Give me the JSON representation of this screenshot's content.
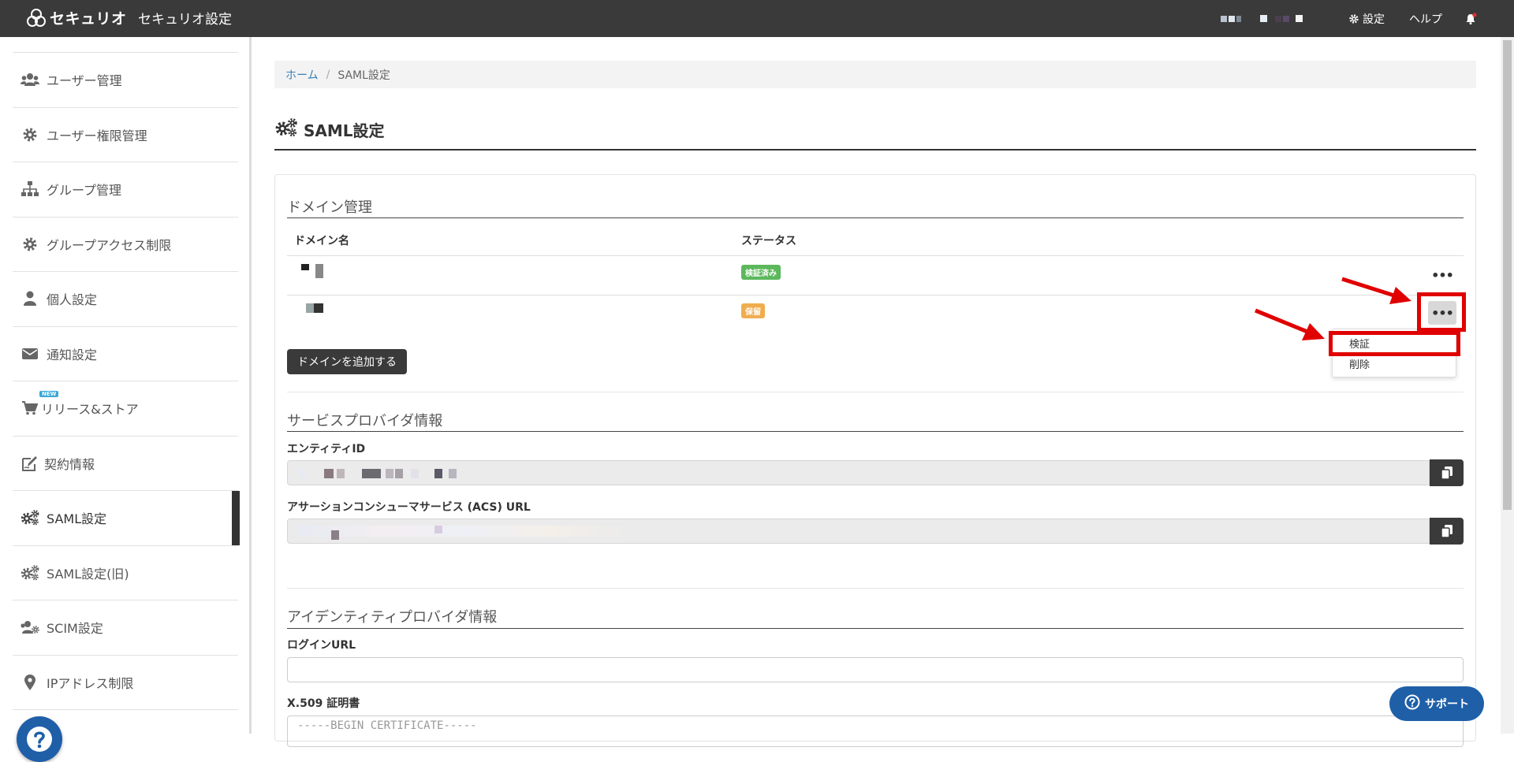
{
  "header": {
    "logo_text": "セキュリオ",
    "app_title": "セキュリオ設定",
    "settings_label": "設定",
    "help_label": "ヘルプ"
  },
  "sidebar": {
    "items": [
      {
        "label": "ユーザー管理",
        "icon": "users-icon"
      },
      {
        "label": "ユーザー権限管理",
        "icon": "gear-icon"
      },
      {
        "label": "グループ管理",
        "icon": "sitemap-icon"
      },
      {
        "label": "グループアクセス制限",
        "icon": "gear-icon"
      },
      {
        "label": "個人設定",
        "icon": "user-icon"
      },
      {
        "label": "通知設定",
        "icon": "envelope-icon"
      },
      {
        "label": "リリース&ストア",
        "icon": "cart-icon",
        "badge": "NEW"
      },
      {
        "label": "契約情報",
        "icon": "contract-edit-icon"
      },
      {
        "label": "SAML設定",
        "icon": "gears-icon",
        "active": true
      },
      {
        "label": "SAML設定(旧)",
        "icon": "gears-icon"
      },
      {
        "label": "SCIM設定",
        "icon": "users-gear-icon"
      },
      {
        "label": "IPアドレス制限",
        "icon": "map-pin-icon"
      }
    ]
  },
  "breadcrumb": {
    "home": "ホーム",
    "sep": "/",
    "current": "SAML設定"
  },
  "page": {
    "title": "SAML設定"
  },
  "domain_section": {
    "title": "ドメイン管理",
    "col_domain": "ドメイン名",
    "col_status": "ステータス",
    "rows": [
      {
        "status": "検証済み",
        "status_type": "ok"
      },
      {
        "status": "保留",
        "status_type": "hold"
      }
    ],
    "menu_items": [
      "検証",
      "削除"
    ],
    "add_button": "ドメインを追加する",
    "more_symbol": "•••"
  },
  "sp_section": {
    "title": "サービスプロバイダ情報",
    "entity_id_label": "エンティティID",
    "acs_url_label": "アサーションコンシューマサービス (ACS) URL"
  },
  "idp_section": {
    "title": "アイデンティティプロバイダ情報",
    "login_url_label": "ログインURL",
    "cert_label": "X.509 証明書",
    "cert_placeholder": "-----BEGIN CERTIFICATE-----"
  },
  "support": {
    "label": "サポート"
  },
  "colors": {
    "header_bg": "#3a3a3a",
    "accent_blue": "#1f5fa8",
    "status_ok": "#5cb85c",
    "status_hold": "#f0ad4e",
    "annotation_red": "#e00000"
  }
}
